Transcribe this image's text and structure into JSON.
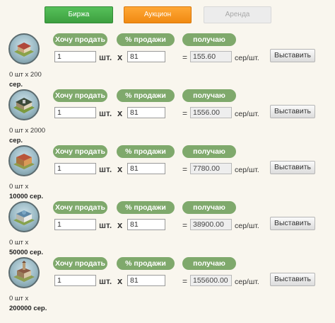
{
  "tabs": {
    "birzha": "Биржа",
    "auction": "Аукцион",
    "arenda": "Аренда",
    "colors": {
      "birzha": "#4caf50",
      "auction": "#f7941d",
      "arenda": "#ececec"
    }
  },
  "labels": {
    "want_sell": "Хочу продать",
    "pct_sale": "% продажи",
    "receive": "получаю",
    "sht": "шт.",
    "mult": "x",
    "eq": "=",
    "unit": "сер/шт.",
    "post_button": "Выставить"
  },
  "rows": [
    {
      "stock_line1": "0 шт x 200",
      "stock_line2": "сер.",
      "qty": "1",
      "pct": "81",
      "result": "155.60",
      "building_icon": "mansion-icon"
    },
    {
      "stock_line1": "0 шт x 2000",
      "stock_line2": "сер.",
      "qty": "1",
      "pct": "81",
      "result": "1556.00",
      "building_icon": "estate-icon"
    },
    {
      "stock_line1": "0 шт x",
      "stock_line2": "10000 сер.",
      "qty": "1",
      "pct": "81",
      "result": "7780.00",
      "building_icon": "factory-icon"
    },
    {
      "stock_line1": "0 шт x",
      "stock_line2": "50000 сер.",
      "qty": "1",
      "pct": "81",
      "result": "38900.00",
      "building_icon": "palace-icon"
    },
    {
      "stock_line1": "0 шт x",
      "stock_line2": "200000 сер.",
      "qty": "1",
      "pct": "81",
      "result": "155600.00",
      "building_icon": "tower-icon"
    }
  ]
}
